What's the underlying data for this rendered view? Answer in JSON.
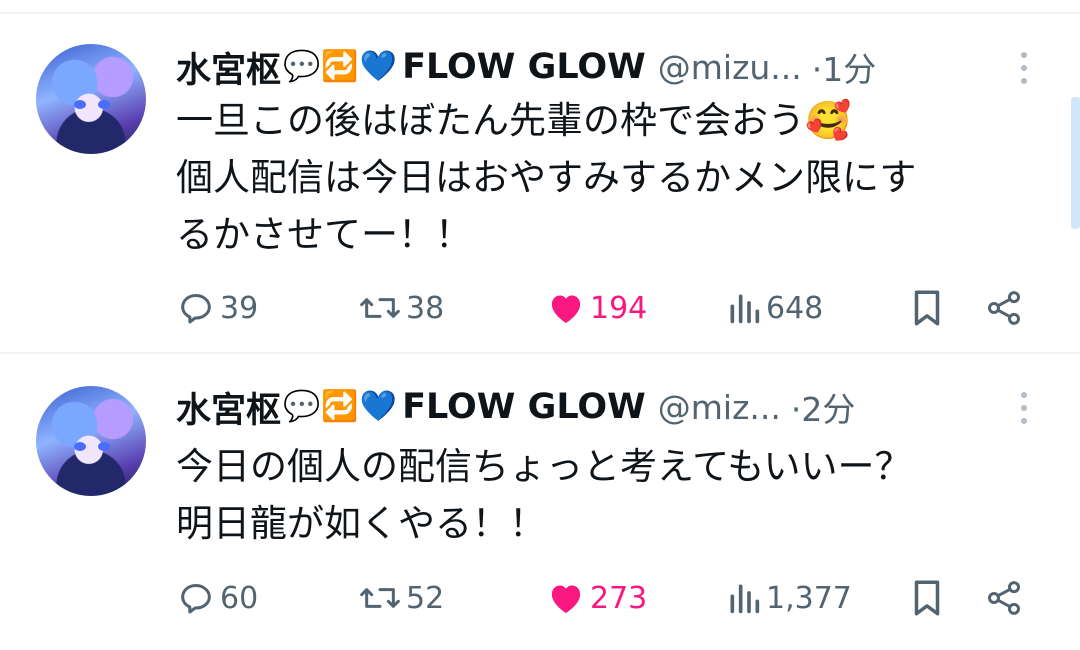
{
  "colors": {
    "text": "#0f1419",
    "secondary": "#536471",
    "like": "#f91880",
    "divider": "#eff3f4"
  },
  "tweets": [
    {
      "name": "水宮枢",
      "emoji_icons": [
        "speech-balloon-icon",
        "retweet-emoji-icon",
        "blue-heart-icon"
      ],
      "emoji_glyphs": [
        "💬",
        "🔁",
        "💙"
      ],
      "group": "FLOW GLOW",
      "handle": "@mizu...",
      "time": "·1分",
      "lines": [
        "一旦この後はぼたん先輩の枠で会おう🥰",
        "個人配信は今日はおやすみするかメン限にす",
        "るかさせてー！！"
      ],
      "replies": "39",
      "retweets": "38",
      "likes": "194",
      "views": "648",
      "liked": true
    },
    {
      "name": "水宮枢",
      "emoji_icons": [
        "speech-balloon-icon",
        "retweet-emoji-icon",
        "blue-heart-icon"
      ],
      "emoji_glyphs": [
        "💬",
        "🔁",
        "💙"
      ],
      "group": "FLOW GLOW",
      "handle": "@miz...",
      "time": "·2分",
      "lines": [
        "今日の個人の配信ちょっと考えてもいいー？",
        "明日龍が如くやる！！"
      ],
      "replies": "60",
      "retweets": "52",
      "likes": "273",
      "views": "1,377",
      "liked": true
    }
  ]
}
